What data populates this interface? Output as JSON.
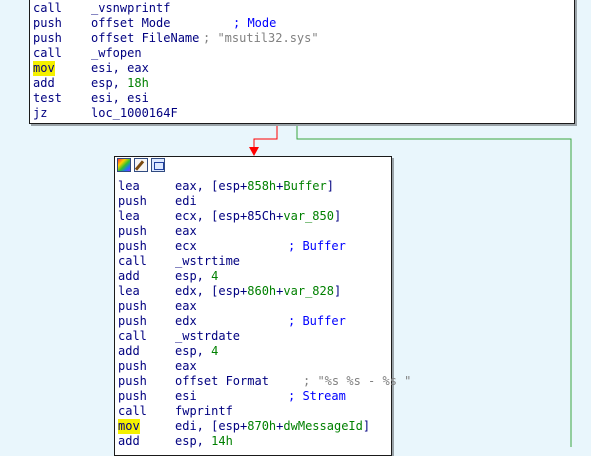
{
  "top_block": [
    {
      "mn": "call",
      "op": "_vsnwprintf",
      "comment": ""
    },
    {
      "mn": "push",
      "op": "offset Mode",
      "comment": "; Mode"
    },
    {
      "mn": "push",
      "op": "offset FileName",
      "comment": "; \"msutil32.sys\""
    },
    {
      "mn": "call",
      "op": "_wfopen",
      "comment": ""
    },
    {
      "mn": "mov",
      "op": "esi, eax",
      "comment": "",
      "highlight": true
    },
    {
      "mn": "add",
      "op": "esp, 18h",
      "comment": ""
    },
    {
      "mn": "test",
      "op": "esi, esi",
      "comment": ""
    },
    {
      "mn": "jz",
      "op": "loc_1000164F",
      "comment": ""
    }
  ],
  "main_block": [
    {
      "mn": "lea",
      "op": "eax, [esp+858h+Buffer]",
      "comment": ""
    },
    {
      "mn": "push",
      "op": "edi",
      "comment": ""
    },
    {
      "mn": "lea",
      "op": "ecx, [esp+85Ch+var_850]",
      "comment": ""
    },
    {
      "mn": "push",
      "op": "eax",
      "comment": ""
    },
    {
      "mn": "push",
      "op": "ecx",
      "comment": "; Buffer"
    },
    {
      "mn": "call",
      "op": "_wstrtime",
      "comment": ""
    },
    {
      "mn": "add",
      "op": "esp, 4",
      "comment": ""
    },
    {
      "mn": "lea",
      "op": "edx, [esp+860h+var_828]",
      "comment": ""
    },
    {
      "mn": "push",
      "op": "eax",
      "comment": ""
    },
    {
      "mn": "push",
      "op": "edx",
      "comment": "; Buffer"
    },
    {
      "mn": "call",
      "op": "_wstrdate",
      "comment": ""
    },
    {
      "mn": "add",
      "op": "esp, 4",
      "comment": ""
    },
    {
      "mn": "push",
      "op": "eax",
      "comment": ""
    },
    {
      "mn": "push",
      "op": "offset Format",
      "comment": "; \"%s %s - %s \""
    },
    {
      "mn": "push",
      "op": "esi",
      "comment": "; Stream"
    },
    {
      "mn": "call",
      "op": "fwprintf",
      "comment": ""
    },
    {
      "mn": "mov",
      "op": "edi, [esp+870h+dwMessageId]",
      "comment": "",
      "highlight": true
    },
    {
      "mn": "add",
      "op": "esp, 14h",
      "comment": ""
    }
  ],
  "toolbar_icons": [
    "color-palette-icon",
    "edit-pencil-icon",
    "graph-view-icon"
  ],
  "edge_colors": {
    "false_branch": "#ff0000",
    "true_branch": "#3aa640"
  }
}
